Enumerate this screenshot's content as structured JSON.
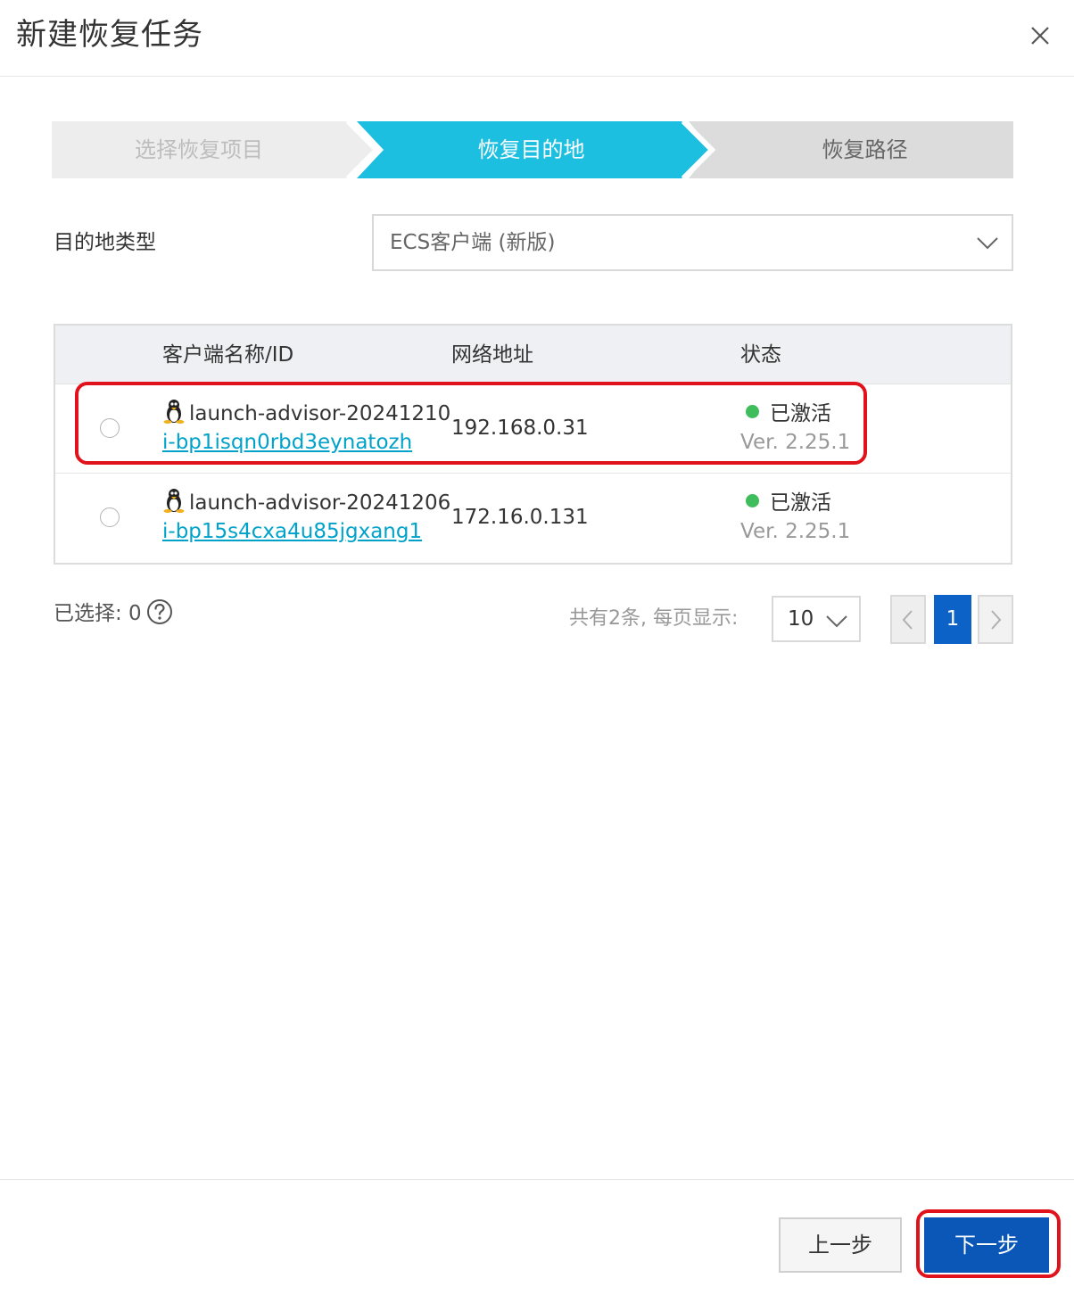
{
  "dialog": {
    "title": "新建恢复任务",
    "close_icon": "close-icon"
  },
  "steps": [
    {
      "label": "选择恢复项目",
      "state": "done"
    },
    {
      "label": "恢复目的地",
      "state": "active"
    },
    {
      "label": "恢复路径",
      "state": "pending"
    }
  ],
  "colors": {
    "step_active": "#1cbfe0",
    "step_inactive": "#ededed",
    "step_pending": "#dcdcdc",
    "link": "#00a2ca",
    "status_active": "#3fbd5c",
    "primary": "#0a57b8",
    "page_current": "#0c62c6",
    "highlight": "#e0131c"
  },
  "destination": {
    "label": "目的地类型",
    "selected": "ECS客户端 (新版)"
  },
  "table": {
    "columns": {
      "name": "客户端名称/ID",
      "ip": "网络地址",
      "status": "状态"
    },
    "rows": [
      {
        "name": "launch-advisor-20241210",
        "id": "i-bp1isqn0rbd3eynatozh",
        "ip": "192.168.0.31",
        "status": "已激活",
        "version": "Ver. 2.25.1",
        "os_icon": "linux-penguin-icon"
      },
      {
        "name": "launch-advisor-20241206",
        "id": "i-bp15s4cxa4u85jgxang1",
        "ip": "172.16.0.131",
        "status": "已激活",
        "version": "Ver. 2.25.1",
        "os_icon": "linux-penguin-icon"
      }
    ]
  },
  "selection": {
    "text": "已选择: 0"
  },
  "pagination": {
    "total_text": "共有2条, 每页显示:",
    "page_size": "10",
    "current_page": "1"
  },
  "footer": {
    "prev_label": "上一步",
    "next_label": "下一步"
  }
}
